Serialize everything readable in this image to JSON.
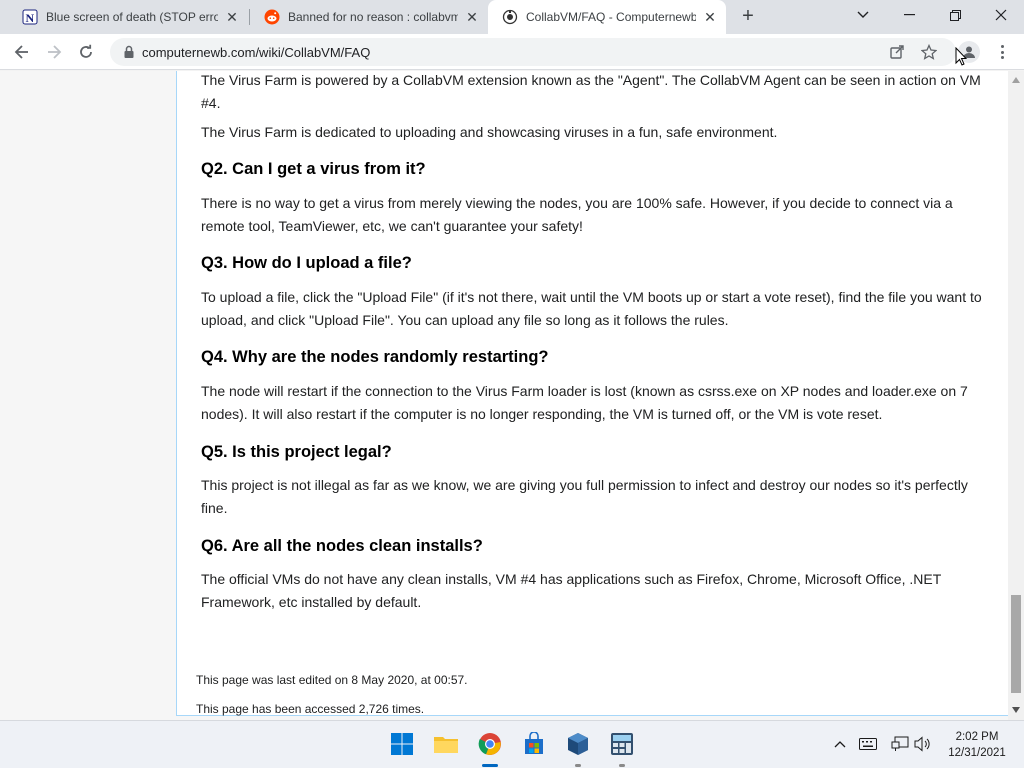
{
  "browser": {
    "tabs": [
      {
        "title": "Blue screen of death (STOP error",
        "icon": "notion-n-icon"
      },
      {
        "title": "Banned for no reason : collabvm",
        "icon": "reddit-icon"
      },
      {
        "title": "CollabVM/FAQ - Computernewb",
        "icon": "computernewb-icon",
        "active": true
      }
    ],
    "url": "computernewb.com/wiki/CollabVM/FAQ"
  },
  "article": {
    "intro_1": "The Virus Farm is powered by a CollabVM extension known as the \"Agent\". The CollabVM Agent can be seen in action on VM #4.",
    "intro_2": "The Virus Farm is dedicated to uploading and showcasing viruses in a fun, safe environment.",
    "faqs": [
      {
        "q": "Q2. Can I get a virus from it?",
        "a": "There is no way to get a virus from merely viewing the nodes, you are 100% safe. However, if you decide to connect via a remote tool, TeamViewer, etc, we can't guarantee your safety!"
      },
      {
        "q": "Q3. How do I upload a file?",
        "a": "To upload a file, click the \"Upload File\" (if it's not there, wait until the VM boots up or start a vote reset), find the file you want to upload, and click \"Upload File\". You can upload any file so long as it follows the rules."
      },
      {
        "q": "Q4. Why are the nodes randomly restarting?",
        "a": "The node will restart if the connection to the Virus Farm loader is lost (known as csrss.exe on XP nodes and loader.exe on 7 nodes). It will also restart if the computer is no longer responding, the VM is turned off, or the VM is vote reset."
      },
      {
        "q": "Q5. Is this project legal?",
        "a": "This project is not illegal as far as we know, we are giving you full permission to infect and destroy our nodes so it's perfectly fine."
      },
      {
        "q": "Q6. Are all the nodes clean installs?",
        "a": "The official VMs do not have any clean installs, VM #4 has applications such as Firefox, Chrome, Microsoft Office, .NET Framework, etc installed by default."
      }
    ]
  },
  "footer": {
    "last_edited": "This page was last edited on 8 May 2020, at 00:57.",
    "accessed": "This page has been accessed 2,726 times."
  },
  "taskbar": {
    "apps": [
      "start-icon",
      "file-explorer-icon",
      "chrome-icon",
      "microsoft-store-icon",
      "virtualbox-icon",
      "calculator-app-icon"
    ],
    "time": "2:02 PM",
    "date": "12/31/2021"
  },
  "colors": {
    "link_border": "#a7d7f9",
    "taskbar_accent": "#0067c0"
  }
}
